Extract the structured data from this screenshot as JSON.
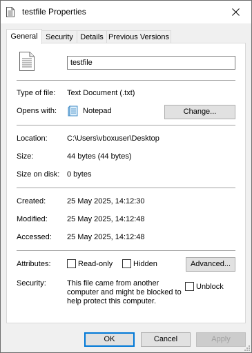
{
  "window": {
    "title": "testfile Properties"
  },
  "tabs": [
    "General",
    "Security",
    "Details",
    "Previous Versions"
  ],
  "general": {
    "filename": "testfile",
    "type_label": "Type of file:",
    "type_value": "Text Document (.txt)",
    "opens_label": "Opens with:",
    "opens_value": "Notepad",
    "change_button": "Change...",
    "location_label": "Location:",
    "location_value": "C:\\Users\\vboxuser\\Desktop",
    "size_label": "Size:",
    "size_value": "44 bytes (44 bytes)",
    "size_disk_label": "Size on disk:",
    "size_disk_value": "0 bytes",
    "created_label": "Created:",
    "created_value": "25 May 2025, 14:12:30",
    "modified_label": "Modified:",
    "modified_value": "25 May 2025, 14:12:48",
    "accessed_label": "Accessed:",
    "accessed_value": "25 May 2025, 14:12:48",
    "attributes_label": "Attributes:",
    "readonly_label": "Read-only",
    "hidden_label": "Hidden",
    "advanced_button": "Advanced...",
    "security_label": "Security:",
    "security_line1": "This file came from another",
    "security_line2": "computer and might be blocked to",
    "security_line3": "help protect this computer.",
    "unblock_label": "Unblock"
  },
  "footer": {
    "ok": "OK",
    "cancel": "Cancel",
    "apply": "Apply"
  },
  "icons": {
    "title": "document-icon",
    "file": "text-file-icon",
    "app": "notepad-icon",
    "close": "close-icon"
  }
}
